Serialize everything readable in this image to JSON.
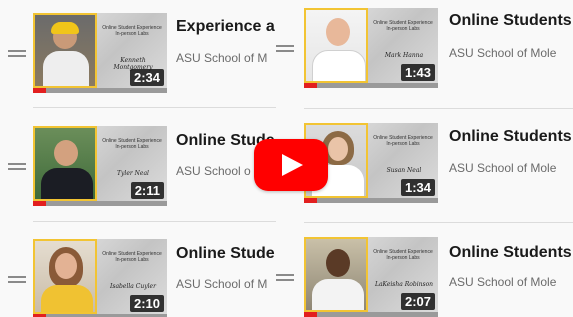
{
  "player": {
    "play_icon": "youtube-play-icon",
    "accent": "#ff0000"
  },
  "videos_left": [
    {
      "title": "Experience a",
      "channel": "ASU School of M",
      "duration": "2:34",
      "promo_title": "Online Student Experience In-person Labs",
      "signature": "Kenneth Montgomery",
      "progress": 0.1
    },
    {
      "title": "Online Stude",
      "channel": "ASU School o",
      "duration": "2:11",
      "promo_title": "Online Student Experience In-person Labs",
      "signature": "Tyler Neal",
      "progress": 0.1
    },
    {
      "title": "Online Stude",
      "channel": "ASU School of M",
      "duration": "2:10",
      "promo_title": "Online Student Experience In-person Labs",
      "signature": "Isabella Cuyler",
      "progress": 0.1
    }
  ],
  "videos_right": [
    {
      "title": "Online Students",
      "channel": "ASU School of Mole",
      "duration": "1:43",
      "promo_title": "Online Student Experience In-person Labs",
      "signature": "Mark Hanna",
      "progress": 0.1
    },
    {
      "title": "Online Students",
      "channel": "ASU School of Mole",
      "duration": "1:34",
      "promo_title": "Online Student Experience In-person Labs",
      "signature": "Susan Neal",
      "progress": 0.1
    },
    {
      "title": "Online Students",
      "channel": "ASU School of Mole",
      "duration": "2:07",
      "promo_title": "Online Student Experience In-person Labs",
      "signature": "LaKeisha Robinson",
      "progress": 0.1
    }
  ]
}
